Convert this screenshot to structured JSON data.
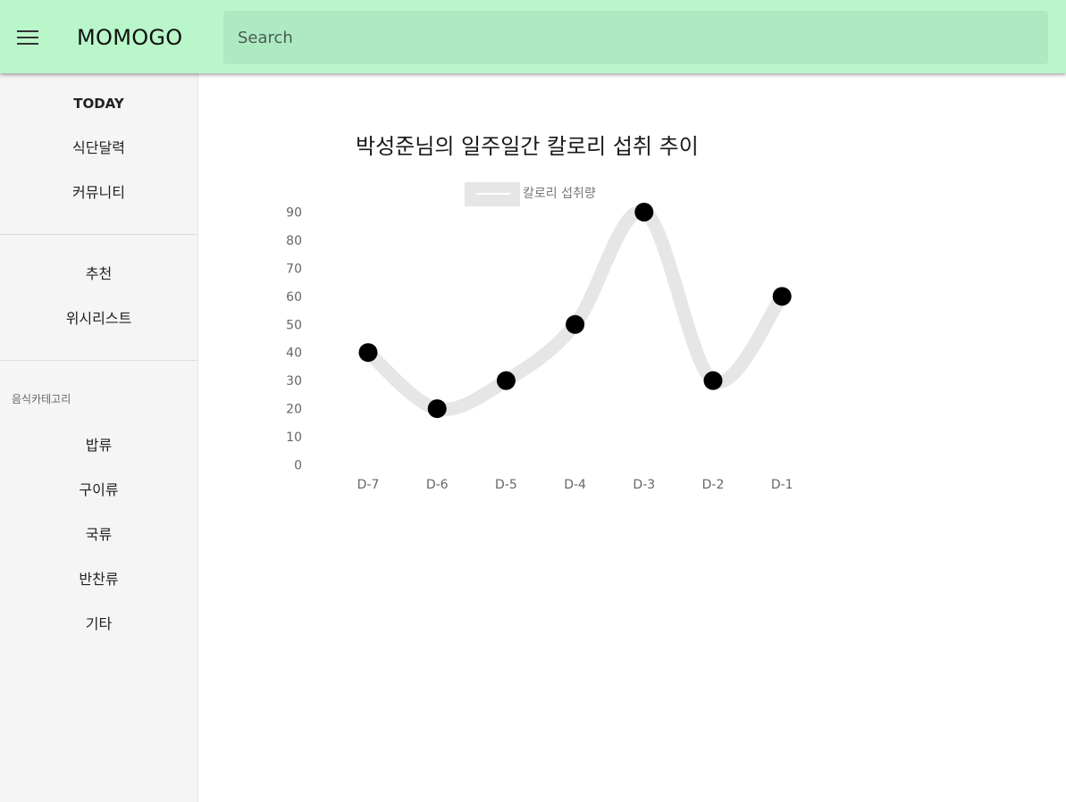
{
  "app": {
    "title": "MOMOGO",
    "menu_icon": "hamburger-menu-icon",
    "search": {
      "placeholder": "Search",
      "value": ""
    }
  },
  "drawer": {
    "group1": [
      "TODAY",
      "식단달력",
      "커뮤니티"
    ],
    "group2": [
      "추천",
      "위시리스트"
    ],
    "category_header": "음식카테고리",
    "categories": [
      "밥류",
      "구이류",
      "국류",
      "반찬류",
      "기타"
    ]
  },
  "colors": {
    "appbar": "#b9f6ca",
    "search_bg": "#aeeac1",
    "drawer_bg": "#f5f5f5",
    "line": "#e6e6e6",
    "point": "#000000"
  },
  "chart_data": {
    "type": "line",
    "title": "박성준님의 일주일간 칼로리 섭취 추이",
    "categories": [
      "D-7",
      "D-6",
      "D-5",
      "D-4",
      "D-3",
      "D-2",
      "D-1"
    ],
    "series": [
      {
        "name": "칼로리 섭취량",
        "values": [
          40,
          20,
          30,
          50,
          90,
          30,
          60
        ]
      }
    ],
    "ylim": [
      0,
      90
    ],
    "yticks": [
      0,
      10,
      20,
      30,
      40,
      50,
      60,
      70,
      80,
      90
    ],
    "legend": "top",
    "grid": false,
    "smooth": true
  }
}
